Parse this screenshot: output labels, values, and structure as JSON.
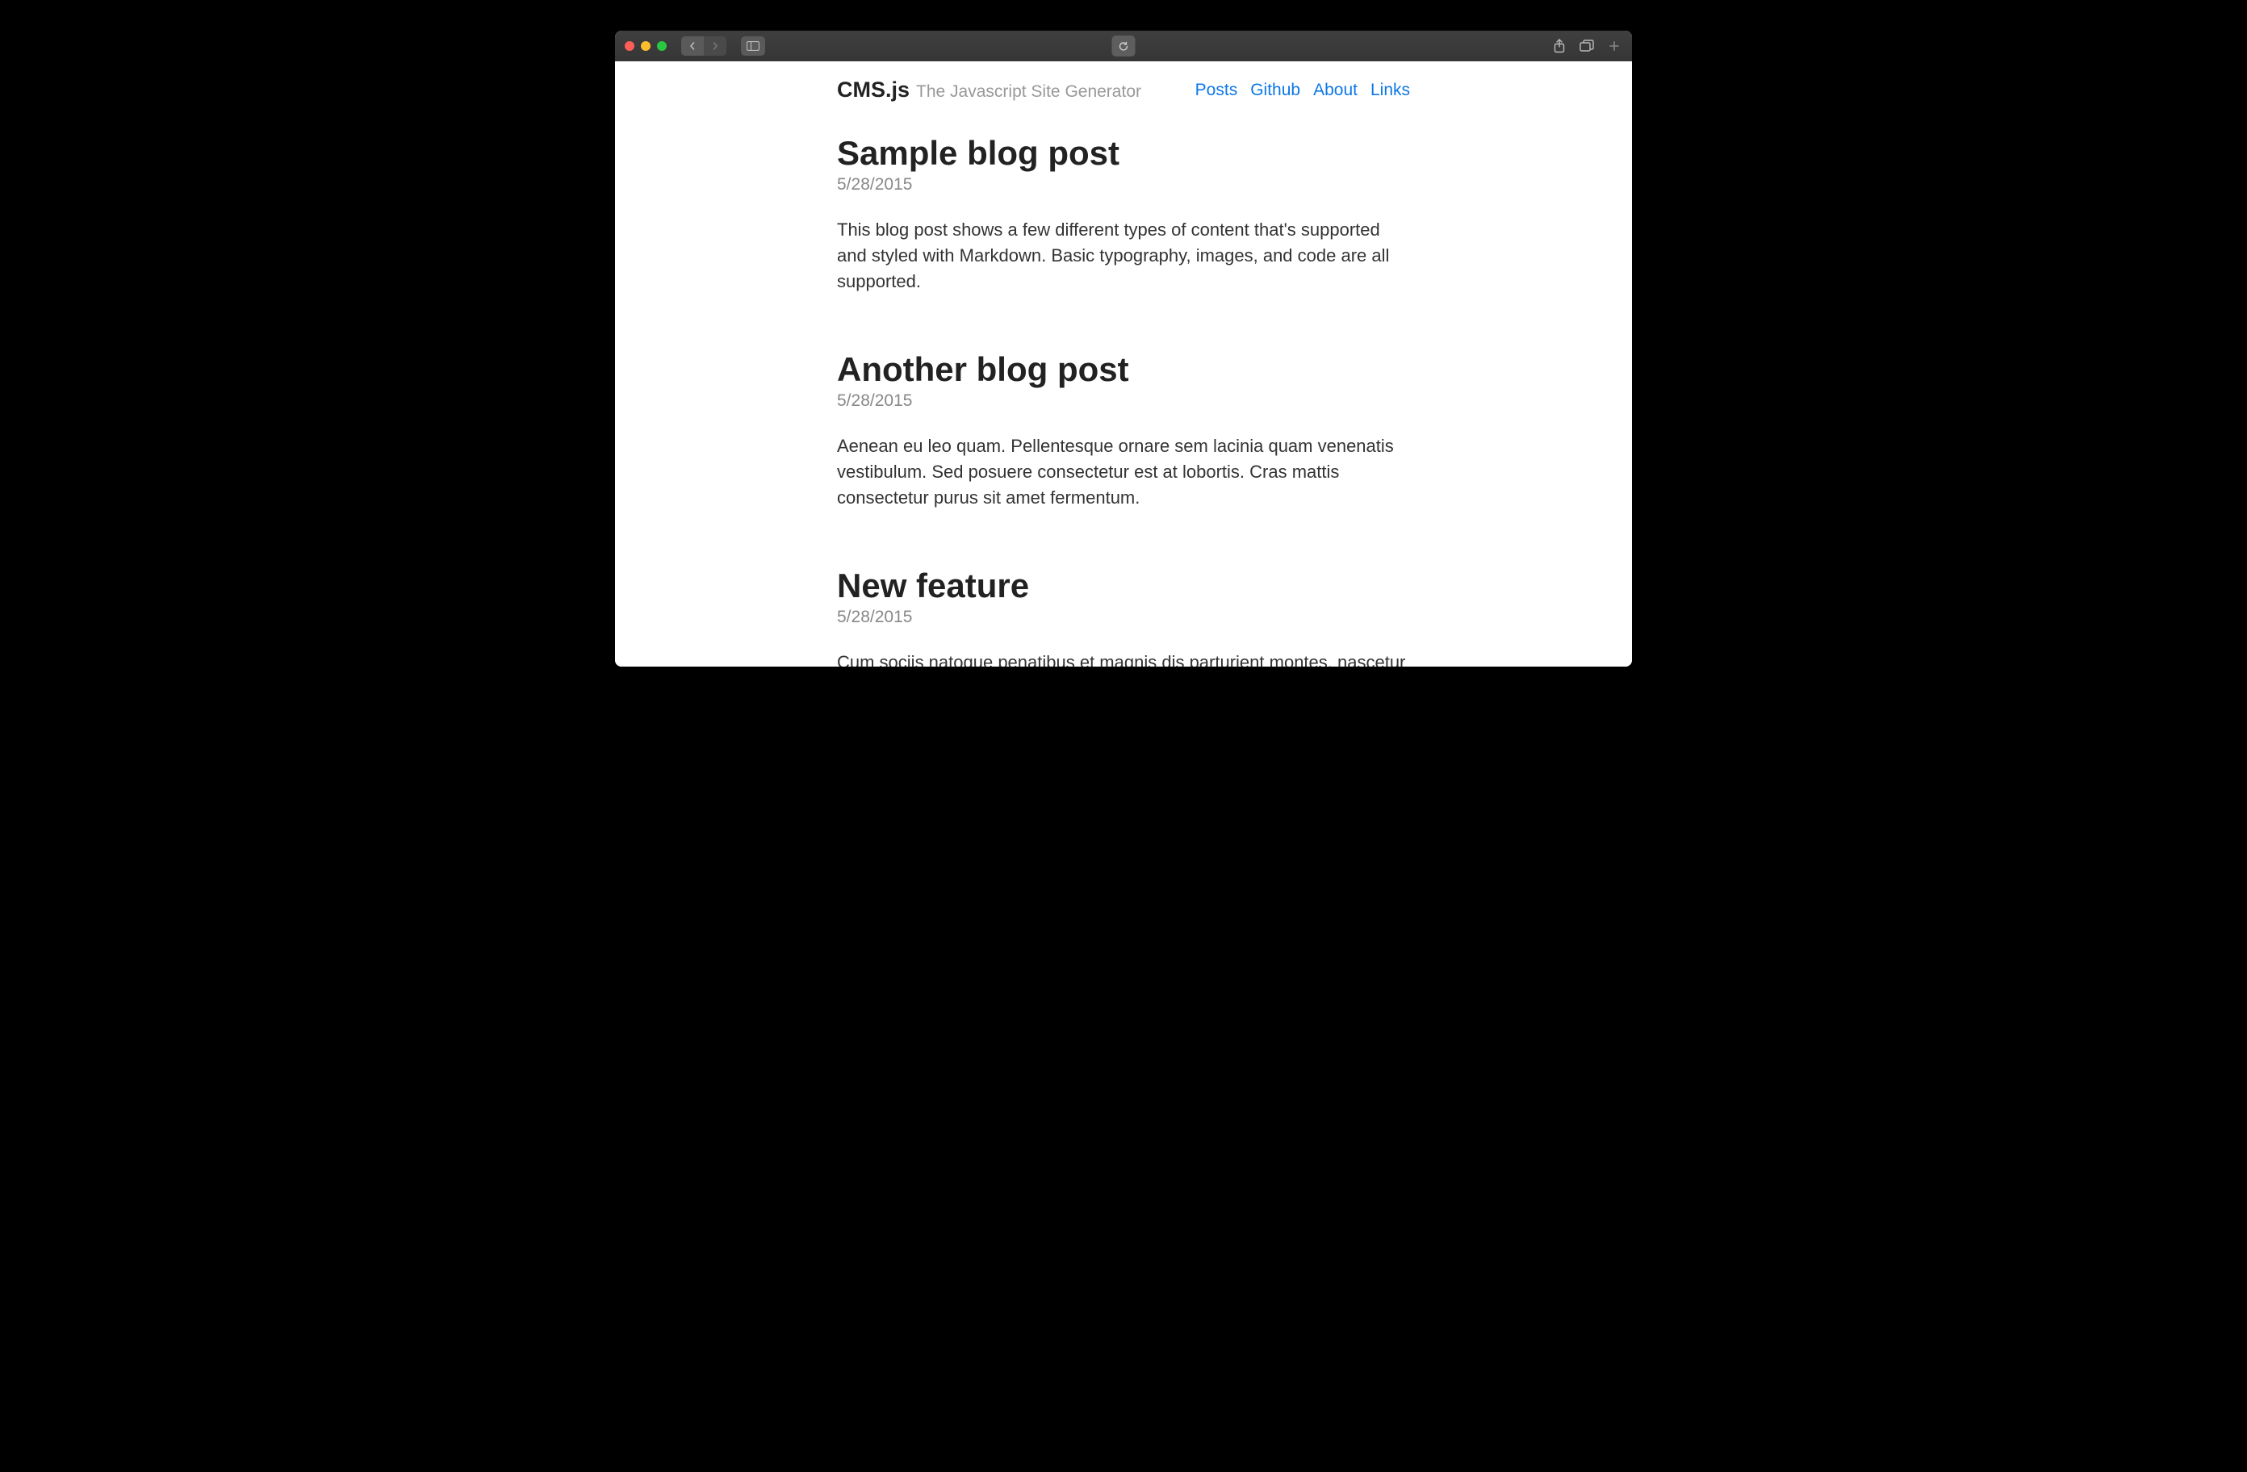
{
  "brand": {
    "name": "CMS.js",
    "tagline": "The Javascript Site Generator"
  },
  "nav": {
    "items": [
      {
        "label": "Posts"
      },
      {
        "label": "Github"
      },
      {
        "label": "About"
      },
      {
        "label": "Links"
      }
    ]
  },
  "posts": [
    {
      "title": "Sample blog post",
      "date": "5/28/2015",
      "body": "This blog post shows a few different types of content that's supported and styled with Markdown. Basic typography, images, and code are all supported."
    },
    {
      "title": "Another blog post",
      "date": "5/28/2015",
      "body": "Aenean eu leo quam. Pellentesque ornare sem lacinia quam venenatis vestibulum. Sed posuere consectetur est at lobortis. Cras mattis consectetur purus sit amet fermentum."
    },
    {
      "title": "New feature",
      "date": "5/28/2015",
      "body": "Cum sociis natoque penatibus et magnis dis parturient montes, nascetur ridiculus mus. Aenean lacinia bibendum nulla sed consectetur."
    }
  ]
}
